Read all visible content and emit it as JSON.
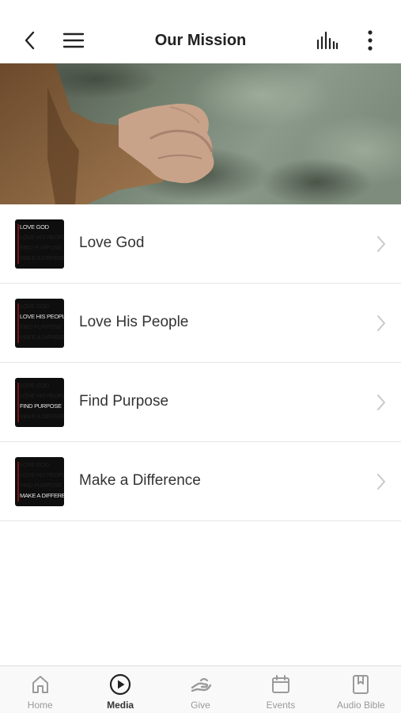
{
  "header": {
    "title": "Our Mission",
    "back_icon": "chevron-left-icon",
    "menu_icon": "hamburger-menu-icon",
    "audio_icon": "audio-levels-icon",
    "more_icon": "more-vertical-icon"
  },
  "hero": {
    "description_icon": "hands-clasped-photo"
  },
  "items": [
    {
      "label": "Love God",
      "thumb_active_line": 0
    },
    {
      "label": "Love His People",
      "thumb_active_line": 1
    },
    {
      "label": "Find Purpose",
      "thumb_active_line": 2
    },
    {
      "label": "Make a Difference",
      "thumb_active_line": 3
    }
  ],
  "thumb_lines": [
    "LOVE GOD",
    "LOVE HIS PEOPLE",
    "FIND PURPOSE",
    "MAKE A DIFFERENCE"
  ],
  "tabs": [
    {
      "label": "Home",
      "icon": "home-icon",
      "active": false
    },
    {
      "label": "Media",
      "icon": "play-circle-icon",
      "active": true
    },
    {
      "label": "Give",
      "icon": "give-hand-icon",
      "active": false
    },
    {
      "label": "Events",
      "icon": "calendar-icon",
      "active": false
    },
    {
      "label": "Audio Bible",
      "icon": "bookmark-book-icon",
      "active": false
    }
  ],
  "colors": {
    "accent_inactive": "#9a9a9a",
    "accent_active": "#333333"
  }
}
